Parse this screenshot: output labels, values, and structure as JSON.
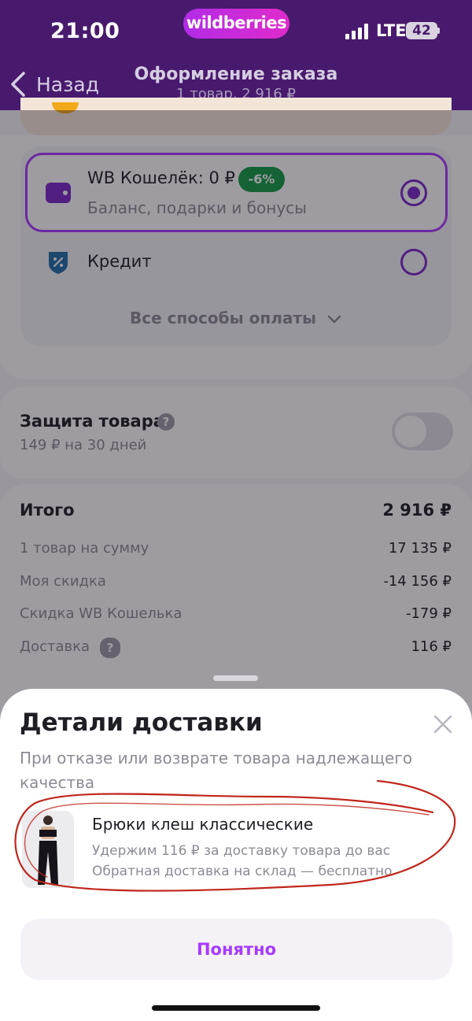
{
  "status_bar": {
    "time": "21:00",
    "network": "LTE",
    "battery": "42"
  },
  "brand": {
    "name": "wildberries"
  },
  "header": {
    "back_label": "Назад",
    "title": "Оформление заказа",
    "subtitle": "1 товар, 2 916 ₽"
  },
  "payment": {
    "wallet": {
      "title": "WB Кошелёк: 0 ₽",
      "badge": "-6%",
      "subtitle": "Баланс, подарки и бонусы",
      "selected": true
    },
    "credit": {
      "title": "Кредит",
      "selected": false
    },
    "all_methods": "Все способы оплаты"
  },
  "protection": {
    "title": "Защита товара",
    "subtitle": "149 ₽ на 30 дней",
    "enabled": false
  },
  "totals": {
    "total_label": "Итого",
    "total_value": "2 916 ₽",
    "rows": [
      {
        "label": "1 товар на сумму",
        "value": "17 135 ₽"
      },
      {
        "label": "Моя скидка",
        "value": "-14 156 ₽"
      },
      {
        "label": "Скидка WB Кошелька",
        "value": "-179 ₽"
      },
      {
        "label": "Доставка",
        "value": "116 ₽"
      }
    ]
  },
  "sheet": {
    "title": "Детали доставки",
    "subtitle": "При отказе или возврате товара надлежащего качества",
    "item": {
      "title": "Брюки клеш классические",
      "line1": "Удержим 116 ₽ за доставку товара до вас",
      "line2": "Обратная доставка на склад — бесплатно"
    },
    "button": "Понятно"
  },
  "colors": {
    "header_bg": "#481a6d",
    "accent": "#a73afd",
    "badge_green": "#149b47",
    "annotation_red": "#c0261b"
  },
  "icons": [
    "chevron-left-icon",
    "wallet-icon",
    "credit-shield-icon",
    "chevron-down-icon",
    "question-icon",
    "close-icon"
  ]
}
